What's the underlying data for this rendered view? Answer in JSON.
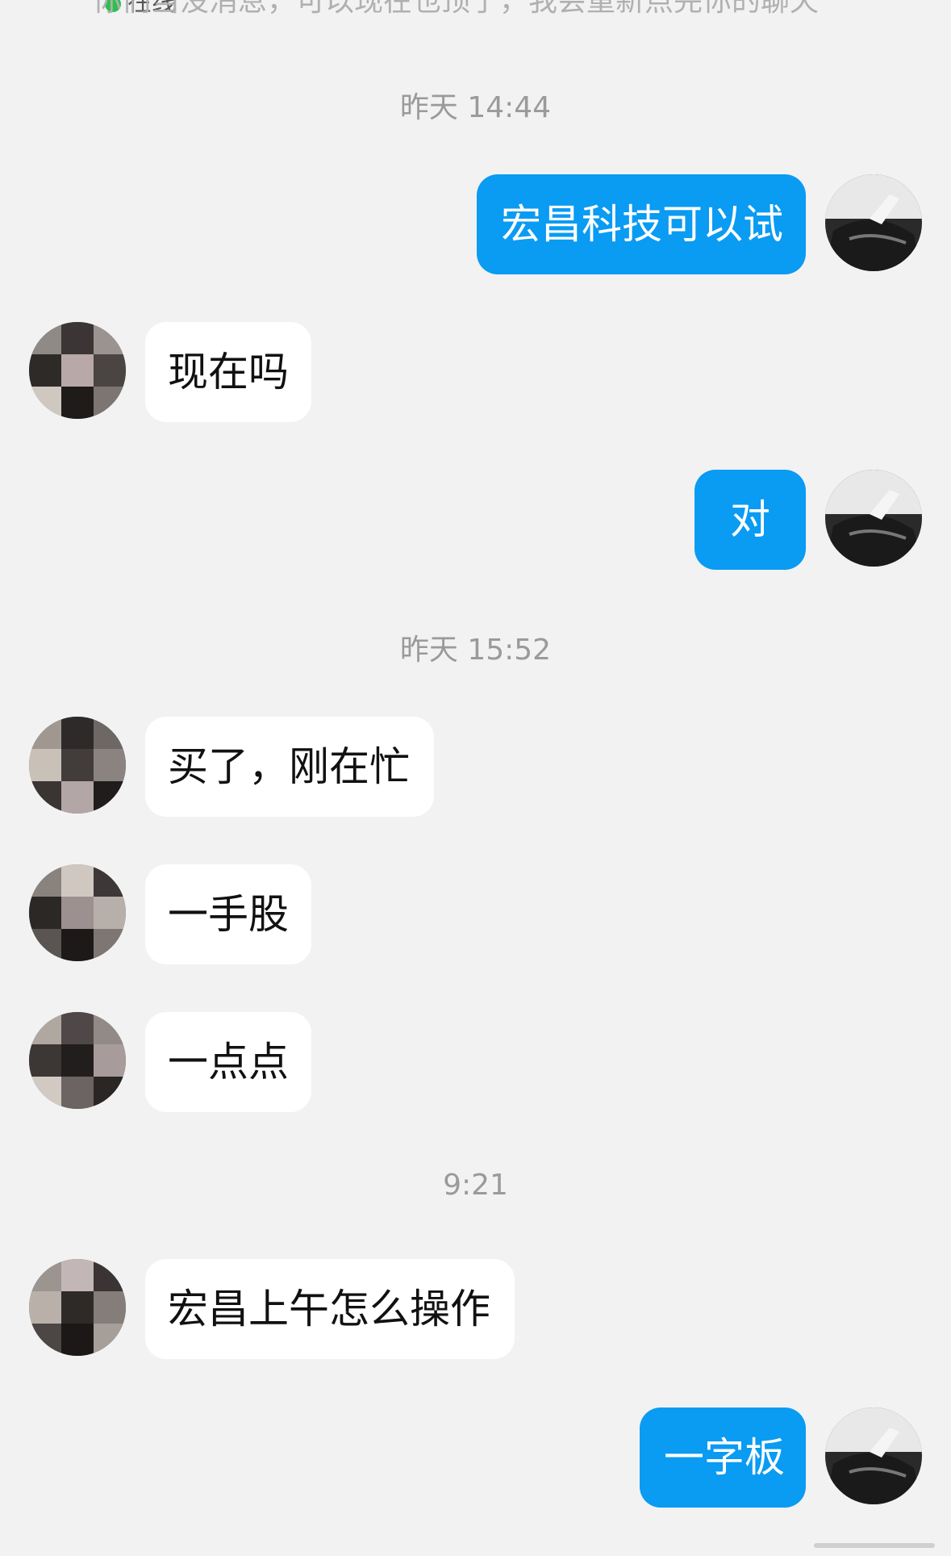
{
  "header": {
    "status": "在线",
    "notice_text": "你们当没消息，可以现在也顶了，我会重新点完你的聊天",
    "notice_link": "消息"
  },
  "colors": {
    "background": "#f2f2f2",
    "incoming_bubble": "#ffffff",
    "outgoing_bubble": "#0a9bf2",
    "timestamp": "#9a9a9a"
  },
  "messages": [
    {
      "type": "timestamp",
      "text": "昨天 14:44"
    },
    {
      "type": "out",
      "text": "宏昌科技可以试"
    },
    {
      "type": "in",
      "text": "现在吗"
    },
    {
      "type": "out",
      "text": "对"
    },
    {
      "type": "timestamp",
      "text": "昨天 15:52"
    },
    {
      "type": "in",
      "text": "买了，刚在忙"
    },
    {
      "type": "in",
      "text": "一手股"
    },
    {
      "type": "in",
      "text": "一点点"
    },
    {
      "type": "timestamp",
      "text": "9:21"
    },
    {
      "type": "in",
      "text": "宏昌上午怎么操作"
    },
    {
      "type": "out",
      "text": "一字板"
    }
  ]
}
